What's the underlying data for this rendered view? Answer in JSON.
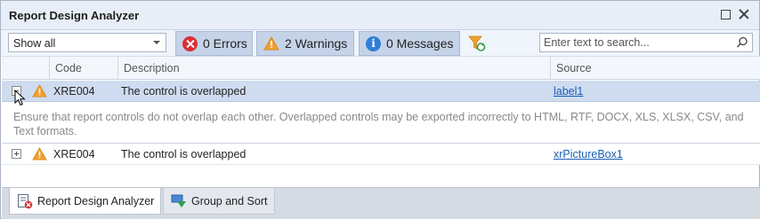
{
  "window": {
    "title": "Report Design Analyzer",
    "maximize_icon": "maximize-icon",
    "close_icon": "close-icon"
  },
  "toolbar": {
    "filter_select": {
      "value": "Show all"
    },
    "errors_label": "0 Errors",
    "warnings_label": "2 Warnings",
    "messages_label": "0 Messages",
    "filter_icon": "filter-clear-icon",
    "search": {
      "placeholder": "Enter text to search...",
      "value": ""
    }
  },
  "grid": {
    "columns": [
      "Code",
      "Description",
      "Source"
    ],
    "rows": [
      {
        "expanded": true,
        "severity": "warning",
        "code": "XRE004",
        "description": "The control is overlapped",
        "source": "label1",
        "detail": "Ensure that report controls do not overlap each other. Overlapped controls may be exported incorrectly to HTML, RTF, DOCX, XLS, XLSX, CSV, and Text formats."
      },
      {
        "expanded": false,
        "severity": "warning",
        "code": "XRE004",
        "description": "The control is overlapped",
        "source": "xrPictureBox1"
      }
    ]
  },
  "tabs": [
    {
      "label": "Report Design Analyzer",
      "icon": "report-design-analyzer-icon",
      "active": true
    },
    {
      "label": "Group and Sort",
      "icon": "group-and-sort-icon",
      "active": false
    }
  ],
  "colors": {
    "error": "#d93036",
    "warning": "#f0a030",
    "info": "#2f7ed8",
    "selected_row": "#cfdcf0",
    "link": "#1a5fb4"
  }
}
